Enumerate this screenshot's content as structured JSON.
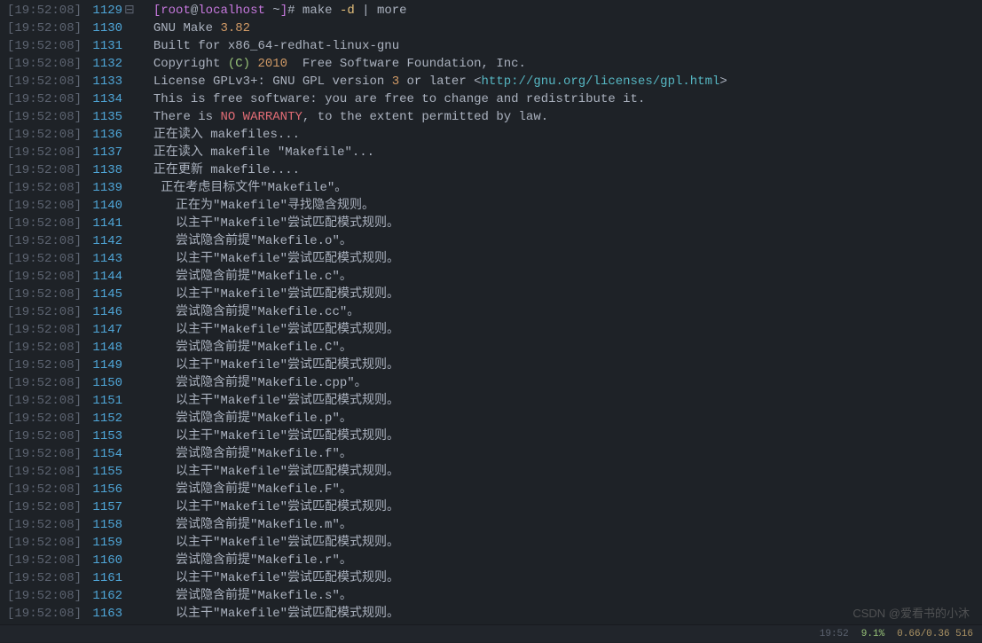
{
  "timestamp": "[19:52:08]",
  "first_lineno": 1129,
  "prompt": {
    "user": "root",
    "host": "localhost",
    "path": "~",
    "symbol": "#",
    "command": "make",
    "flag": "-d",
    "pipe": "|",
    "command2": "more"
  },
  "make_output": {
    "line1": {
      "prefix": "GNU Make ",
      "version": "3.82"
    },
    "line2": "Built for x86_64-redhat-linux-gnu",
    "line3": {
      "prefix": "Copyright ",
      "c": "(C)",
      "year": " 2010",
      "suffix": "  Free Software Foundation, Inc."
    },
    "line4": {
      "prefix": "License GPLv3",
      "plus": "+",
      "mid": ": GNU GPL version ",
      "v": "3",
      "mid2": " or later ",
      "lt": "<",
      "url": "http://gnu.org/licenses/gpl.html",
      "gt": ">"
    },
    "line5": {
      "prefix": "This is free software",
      "colon": ": ",
      "suffix": "you are free to change and redistribute it."
    },
    "line6": {
      "prefix": "There is ",
      "warn": "NO WARRANTY",
      "suffix": ", to the extent permitted by law."
    },
    "line7": "正在读入 makefiles...",
    "line8": "正在读入 makefile \"Makefile\"...",
    "line9": "正在更新 makefile....",
    "line10": " 正在考虑目标文件\"Makefile\"。",
    "line11": "   正在为\"Makefile\"寻找隐含规则。",
    "line12": "   以主干\"Makefile\"尝试匹配模式规则。",
    "line13": "   尝试隐含前提\"Makefile.o\"。",
    "line14": "   以主干\"Makefile\"尝试匹配模式规则。",
    "line15": "   尝试隐含前提\"Makefile.c\"。",
    "line16": "   以主干\"Makefile\"尝试匹配模式规则。",
    "line17": "   尝试隐含前提\"Makefile.cc\"。",
    "line18": "   以主干\"Makefile\"尝试匹配模式规则。",
    "line19": "   尝试隐含前提\"Makefile.C\"。",
    "line20": "   以主干\"Makefile\"尝试匹配模式规则。",
    "line21": "   尝试隐含前提\"Makefile.cpp\"。",
    "line22": "   以主干\"Makefile\"尝试匹配模式规则。",
    "line23": "   尝试隐含前提\"Makefile.p\"。",
    "line24": "   以主干\"Makefile\"尝试匹配模式规则。",
    "line25": "   尝试隐含前提\"Makefile.f\"。",
    "line26": "   以主干\"Makefile\"尝试匹配模式规则。",
    "line27": "   尝试隐含前提\"Makefile.F\"。",
    "line28": "   以主干\"Makefile\"尝试匹配模式规则。",
    "line29": "   尝试隐含前提\"Makefile.m\"。",
    "line30": "   以主干\"Makefile\"尝试匹配模式规则。",
    "line31": "   尝试隐含前提\"Makefile.r\"。",
    "line32": "   以主干\"Makefile\"尝试匹配模式规则。",
    "line33": "   尝试隐含前提\"Makefile.s\"。",
    "line34": "   以主干\"Makefile\"尝试匹配模式规则。"
  },
  "statusbar": {
    "time": "19:52",
    "percent": "9.1%",
    "timing": "0.66/0.36 516"
  },
  "watermark": "CSDN @爱看书的小沐"
}
